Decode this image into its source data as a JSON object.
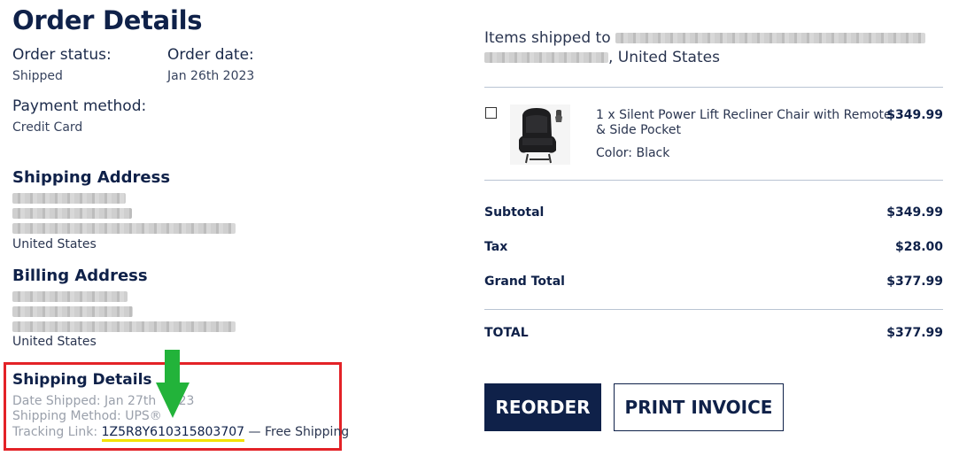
{
  "page": {
    "title": "Order Details"
  },
  "order": {
    "status_label": "Order status:",
    "status_value": "Shipped",
    "date_label": "Order date:",
    "date_value": "Jan 26th 2023",
    "payment_label": "Payment method:",
    "payment_value": "Credit Card"
  },
  "shipping_address": {
    "heading": "Shipping Address",
    "country": "United States"
  },
  "billing_address": {
    "heading": "Billing Address",
    "country": "United States"
  },
  "shipping_details": {
    "heading": "Shipping Details",
    "date_shipped_prefix": "Date Shipped: Jan 27th",
    "date_shipped_suffix": "023",
    "method": "Shipping Method: UPS®",
    "tracking_label": "Tracking Link:",
    "tracking_number": "1Z5R8Y610315803707",
    "tracking_suffix": "— Free Shipping"
  },
  "items_shipped": {
    "prefix": "Items shipped to",
    "suffix": ", United States"
  },
  "item": {
    "title": "1 x Silent Power Lift Recliner Chair with Remote & Side Pocket",
    "price": "$349.99",
    "color": "Color: Black"
  },
  "totals": {
    "subtotal_label": "Subtotal",
    "subtotal_value": "$349.99",
    "tax_label": "Tax",
    "tax_value": "$28.00",
    "grand_label": "Grand Total",
    "grand_value": "$377.99",
    "total_label": "TOTAL",
    "total_value": "$377.99"
  },
  "actions": {
    "reorder": "REORDER",
    "print_invoice": "PRINT INVOICE"
  },
  "colors": {
    "brand_navy": "#0f2149",
    "highlight_box": "#e32227",
    "arrow": "#22b33a",
    "link_underline": "#f2e200"
  }
}
